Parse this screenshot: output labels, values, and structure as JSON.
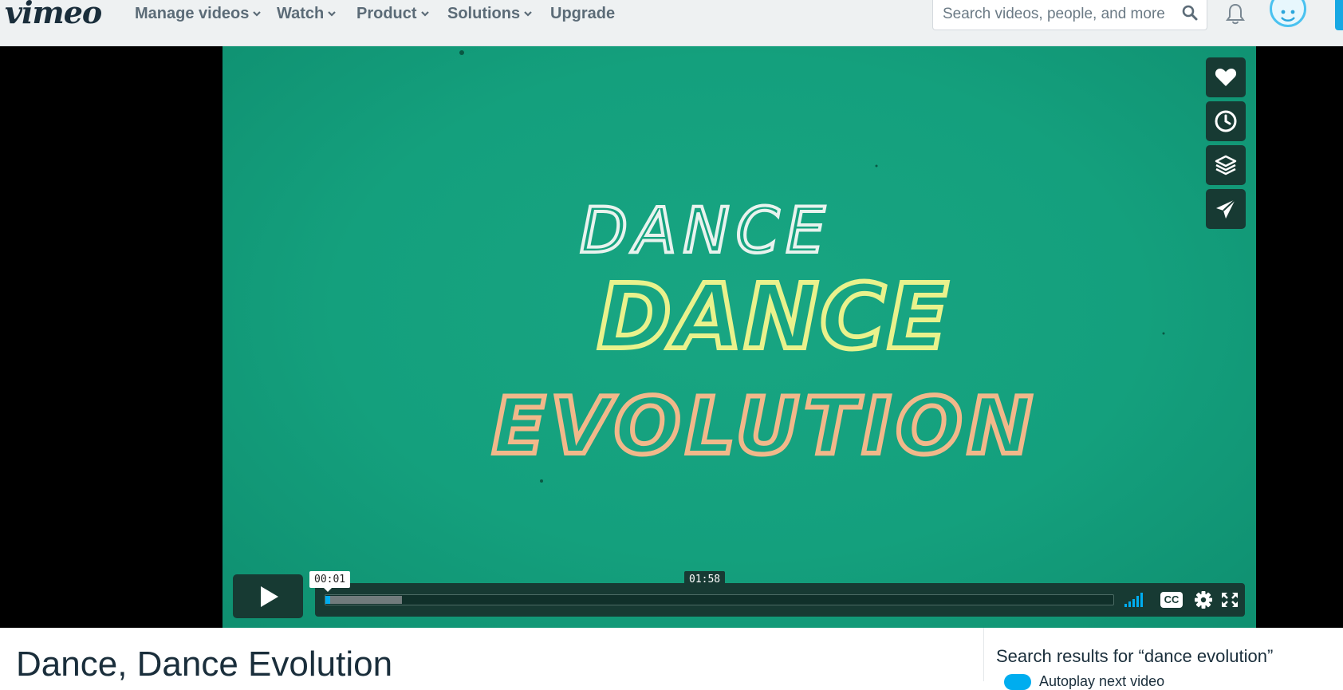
{
  "header": {
    "logo": "vimeo",
    "nav": [
      {
        "label": "Manage videos",
        "dropdown": true
      },
      {
        "label": "Watch",
        "dropdown": true
      },
      {
        "label": "Product",
        "dropdown": true
      },
      {
        "label": "Solutions",
        "dropdown": true
      },
      {
        "label": "Upgrade",
        "dropdown": false
      }
    ],
    "search": {
      "placeholder": "Search videos, people, and more"
    }
  },
  "player": {
    "title_card": {
      "line1": "DANCE",
      "line2": "DANCE",
      "line3": "EVOLUTION"
    },
    "side_actions": [
      "heart-icon",
      "clock-icon",
      "layers-icon",
      "paper-plane-icon"
    ],
    "time_current": "00:01",
    "time_total": "01:58",
    "progress_played": 0.006,
    "progress_buffered": 0.097,
    "controls": {
      "cc_label": "CC"
    }
  },
  "video": {
    "title": "Dance, Dance Evolution"
  },
  "sidebar": {
    "heading": "Search results for “dance evolution”",
    "autoplay_label": "Autoplay next video"
  },
  "colors": {
    "accent": "#00adef",
    "player_bg": "#14a07d",
    "control_bg": "#173a33",
    "text_dark": "#1a2e3b"
  }
}
